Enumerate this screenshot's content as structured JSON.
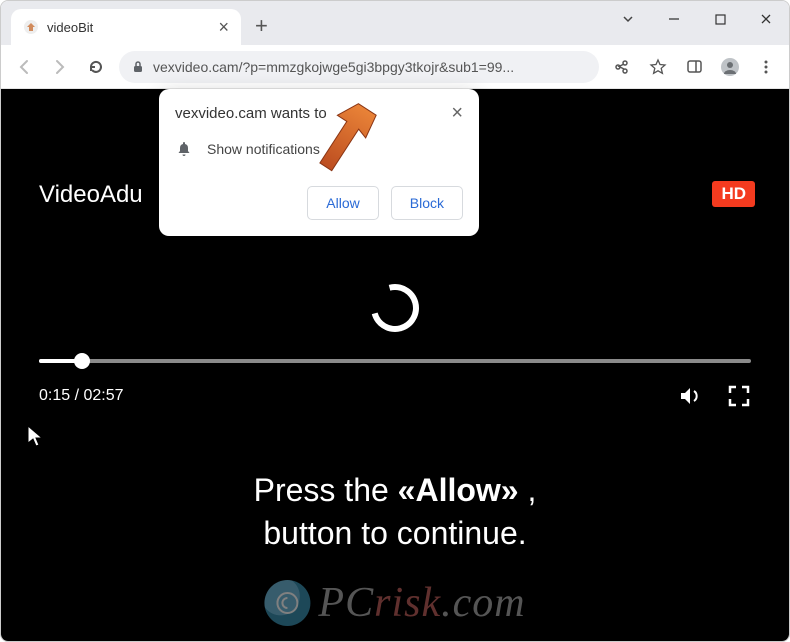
{
  "browser": {
    "tab_title": "videoBit",
    "url": "vexvideo.cam/?p=mmzgkojwge5gi3bpgy3tkojr&sub1=99..."
  },
  "permission": {
    "prompt": "vexvideo.cam wants to",
    "option": "Show notifications",
    "allow": "Allow",
    "block": "Block"
  },
  "page": {
    "brand": "VideoAdu",
    "hd": "HD",
    "time_elapsed": "0:15",
    "time_total": "02:57",
    "instruct_line1a": "Press the ",
    "instruct_line1b": "«Allow»",
    "instruct_line1c": ",",
    "instruct_line2": "button to continue."
  },
  "watermark": {
    "text_a": "PC",
    "text_b": "risk",
    "text_c": ".com"
  }
}
